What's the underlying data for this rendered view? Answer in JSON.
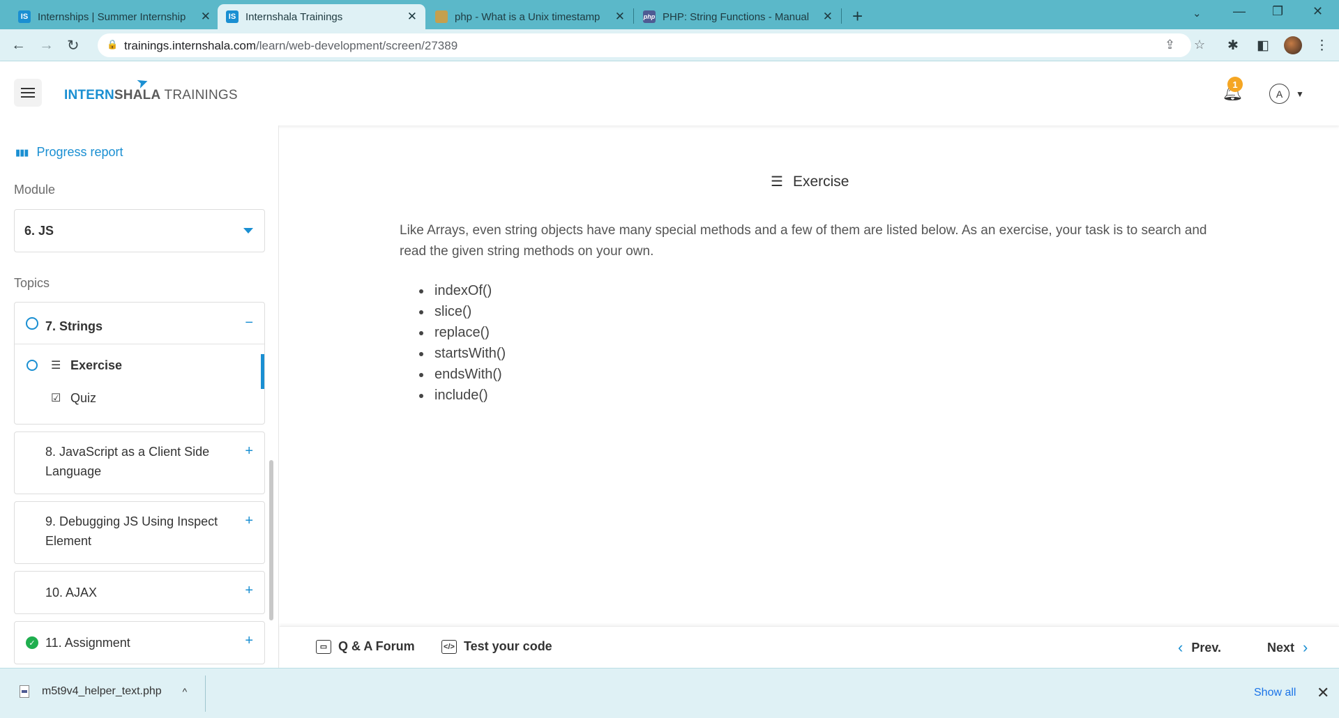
{
  "browser": {
    "tabs": [
      {
        "title": "Internships | Summer Internship",
        "favicon": "IS"
      },
      {
        "title": "Internshala Trainings",
        "favicon": "IS"
      },
      {
        "title": "php - What is a Unix timestamp",
        "favicon": ""
      },
      {
        "title": "PHP: String Functions - Manual",
        "favicon": "php"
      }
    ],
    "url_host": "trainings.internshala.com",
    "url_path": "/learn/web-development/screen/27389"
  },
  "header": {
    "logo_part1": "INTERN",
    "logo_part2": "SHALA",
    "logo_part3": " TRAININGS",
    "notification_count": "1",
    "avatar_letter": "A"
  },
  "sidebar": {
    "progress_label": "Progress report",
    "module_label": "Module",
    "module_value": "6. JS",
    "topics_label": "Topics",
    "topics": [
      {
        "title": "7. Strings",
        "expanded": true,
        "status": "in-progress",
        "items": [
          {
            "label": "Exercise",
            "icon": "lines-icon",
            "active": true
          },
          {
            "label": "Quiz",
            "icon": "checkbox-icon",
            "active": false
          }
        ]
      },
      {
        "title": "8. JavaScript as a Client Side Language",
        "expanded": false
      },
      {
        "title": "9. Debugging JS Using Inspect Element",
        "expanded": false
      },
      {
        "title": "10. AJAX",
        "expanded": false
      },
      {
        "title": "11. Assignment",
        "expanded": false,
        "status": "completed"
      }
    ]
  },
  "main": {
    "heading": "Exercise",
    "description": "Like Arrays, even string objects have many special methods and a few of them are listed below. As an exercise, your task is to search and read the given string methods on your own.",
    "methods": [
      "indexOf()",
      "slice()",
      "replace()",
      "startsWith()",
      "endsWith()",
      "include()"
    ]
  },
  "footer": {
    "qa_label": "Q & A Forum",
    "test_label": "Test your code",
    "prev_label": "Prev.",
    "next_label": "Next"
  },
  "downloads": {
    "file_name": "m5t9v4_helper_text.php",
    "show_all": "Show all"
  },
  "colors": {
    "brand_blue": "#1a8fd2",
    "chrome_teal": "#5bb8c9",
    "success_green": "#1fae4e",
    "badge_orange": "#f5a623"
  }
}
